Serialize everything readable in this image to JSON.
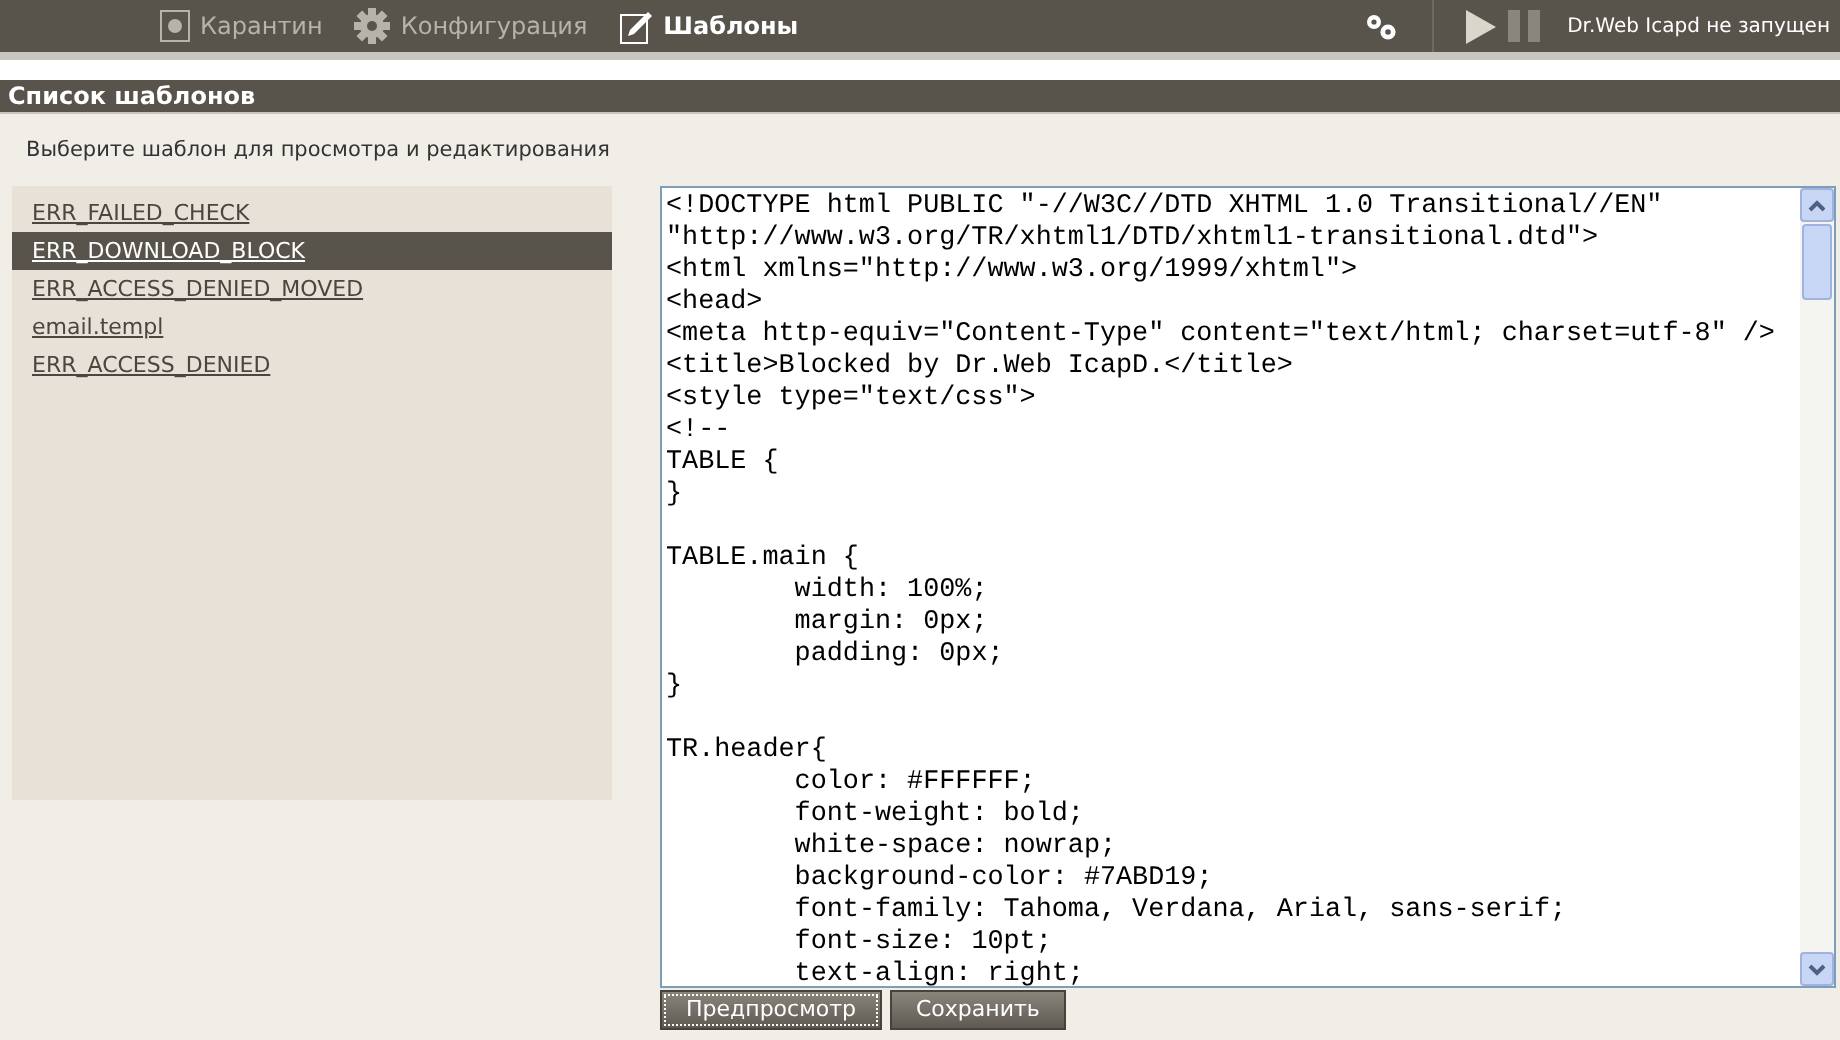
{
  "nav": [
    {
      "label": "Карантин",
      "kind": "quarantine",
      "selected": false
    },
    {
      "label": "Конфигурация",
      "kind": "config",
      "selected": false
    },
    {
      "label": "Шаблоны",
      "kind": "templates",
      "selected": true
    }
  ],
  "status": "Dr.Web Icapd не запущен",
  "section_title": "Список шаблонов",
  "instruction": "Выберите шаблон для просмотра и редактирования",
  "templates": [
    {
      "label": "ERR_FAILED_CHECK",
      "selected": false
    },
    {
      "label": "ERR_DOWNLOAD_BLOCK",
      "selected": true
    },
    {
      "label": "ERR_ACCESS_DENIED_MOVED",
      "selected": false
    },
    {
      "label": "email.templ",
      "selected": false
    },
    {
      "label": "ERR_ACCESS_DENIED",
      "selected": false
    }
  ],
  "editor_text": "<!DOCTYPE html PUBLIC \"-//W3C//DTD XHTML 1.0 Transitional//EN\"\n\"http://www.w3.org/TR/xhtml1/DTD/xhtml1-transitional.dtd\">\n<html xmlns=\"http://www.w3.org/1999/xhtml\">\n<head>\n<meta http-equiv=\"Content-Type\" content=\"text/html; charset=utf-8\" />\n<title>Blocked by Dr.Web IcapD.</title>\n<style type=\"text/css\">\n<!--\nTABLE {\n}\n\nTABLE.main {\n\twidth: 100%;\n\tmargin: 0px;\n\tpadding: 0px;\n}\n\nTR.header{\n\tcolor: #FFFFFF;\n\tfont-weight: bold;\n\twhite-space: nowrap;\n\tbackground-color: #7ABD19;\n\tfont-family: Tahoma, Verdana, Arial, sans-serif;\n\tfont-size: 10pt;\n\ttext-align: right;",
  "buttons": [
    "Предпросмотр",
    "Сохранить"
  ]
}
